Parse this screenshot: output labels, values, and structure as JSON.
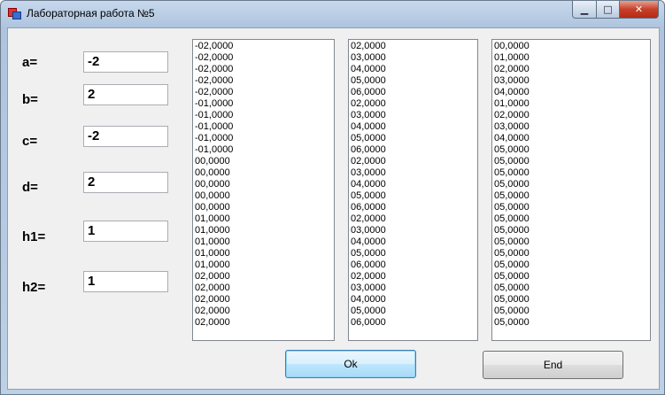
{
  "window": {
    "title": "Лабораторная работа №5",
    "min_glyph": "▁",
    "max_glyph": "□",
    "close_glyph": "✕"
  },
  "fields": [
    {
      "label": "a=",
      "value": "-2"
    },
    {
      "label": "b=",
      "value": "2"
    },
    {
      "label": "c=",
      "value": "-2"
    },
    {
      "label": "d=",
      "value": "2"
    },
    {
      "label": "h1=",
      "value": "1"
    },
    {
      "label": "h2=",
      "value": "1"
    }
  ],
  "lists": {
    "list1": [
      "-02,0000",
      "-02,0000",
      "-02,0000",
      "-02,0000",
      "-02,0000",
      "-01,0000",
      "-01,0000",
      "-01,0000",
      "-01,0000",
      "-01,0000",
      "00,0000",
      "00,0000",
      "00,0000",
      "00,0000",
      "00,0000",
      "01,0000",
      "01,0000",
      "01,0000",
      "01,0000",
      "01,0000",
      "02,0000",
      "02,0000",
      "02,0000",
      "02,0000",
      "02,0000"
    ],
    "list2": [
      "02,0000",
      "03,0000",
      "04,0000",
      "05,0000",
      "06,0000",
      "02,0000",
      "03,0000",
      "04,0000",
      "05,0000",
      "06,0000",
      "02,0000",
      "03,0000",
      "04,0000",
      "05,0000",
      "06,0000",
      "02,0000",
      "03,0000",
      "04,0000",
      "05,0000",
      "06,0000",
      "02,0000",
      "03,0000",
      "04,0000",
      "05,0000",
      "06,0000"
    ],
    "list3": [
      "00,0000",
      "01,0000",
      "02,0000",
      "03,0000",
      "04,0000",
      "01,0000",
      "02,0000",
      "03,0000",
      "04,0000",
      "05,0000",
      "05,0000",
      "05,0000",
      "05,0000",
      "05,0000",
      "05,0000",
      "05,0000",
      "05,0000",
      "05,0000",
      "05,0000",
      "05,0000",
      "05,0000",
      "05,0000",
      "05,0000",
      "05,0000",
      "05,0000"
    ]
  },
  "buttons": {
    "ok": "Ok",
    "end": "End"
  }
}
